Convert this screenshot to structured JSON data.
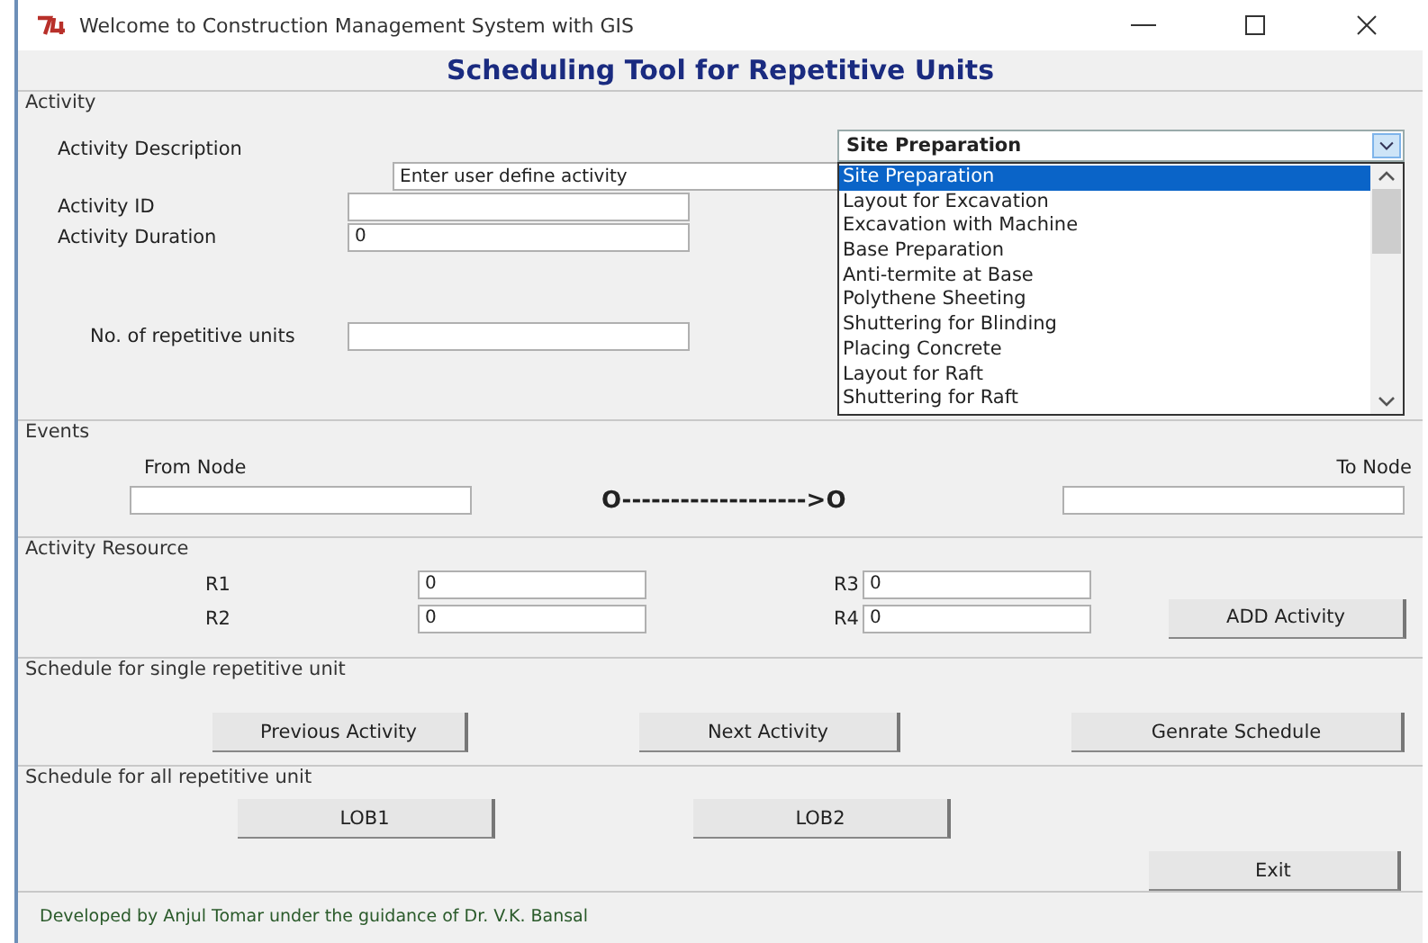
{
  "window": {
    "title": "Welcome to Construction Management System with GIS"
  },
  "heading": "Scheduling Tool for Repetitive Units",
  "activity": {
    "label": "Activity",
    "description_label": "Activity Description",
    "user_activity": {
      "value": "Enter user define activity"
    },
    "fields": [
      {
        "label": "Activity ID"
      },
      {
        "label": "Activity Duration",
        "value": "0"
      }
    ],
    "units": {
      "label": "No. of repetitive units"
    },
    "dropdown": {
      "value": "Site Preparation",
      "options": [
        {
          "label": "Site Preparation",
          "selected": true
        },
        {
          "label": "Layout for Excavation",
          "selected": false
        },
        {
          "label": "Excavation with Machine",
          "selected": false
        },
        {
          "label": "Base Preparation",
          "selected": false
        },
        {
          "label": "Anti-termite at Base",
          "selected": false
        },
        {
          "label": "Polythene Sheeting",
          "selected": false
        },
        {
          "label": "Shuttering for Blinding",
          "selected": false
        },
        {
          "label": "Placing Concrete",
          "selected": false
        },
        {
          "label": "Layout for Raft",
          "selected": false
        },
        {
          "label": "Shuttering for Raft",
          "selected": false
        }
      ]
    }
  },
  "events": {
    "label": "Events",
    "from_label": "From Node",
    "arrow": "O------------------->O",
    "to_label": "To Node"
  },
  "resources": {
    "label": "Activity Resource",
    "items": [
      {
        "label": "R1",
        "value": "0"
      },
      {
        "label": "R2",
        "value": "0"
      },
      {
        "label": "R3",
        "value": "0"
      },
      {
        "label": "R4",
        "value": "0"
      }
    ],
    "button": "ADD Activity"
  },
  "single": {
    "label": "Schedule for single repetitive unit",
    "buttons": [
      "Previous Activity",
      "Next Activity",
      "Genrate Schedule"
    ]
  },
  "all": {
    "label": "Schedule for all repetitive unit",
    "buttons": [
      "LOB1",
      "LOB2"
    ],
    "exit": "Exit"
  },
  "footer": "Developed by Anjul Tomar under the guidance of Dr. V.K. Bansal"
}
